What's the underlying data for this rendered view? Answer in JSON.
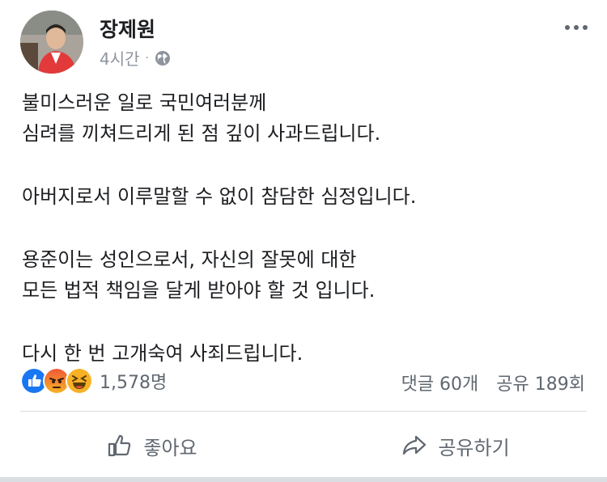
{
  "author": {
    "name": "장제원",
    "time": "4시간",
    "separator": "·"
  },
  "post": {
    "paragraphs": [
      [
        "불미스러운 일로 국민여러분께",
        "심려를 끼쳐드리게 된 점 깊이 사과드립니다."
      ],
      [
        "아버지로서 이루말할 수 없이 참담한 심정입니다."
      ],
      [
        "용준이는 성인으로서, 자신의 잘못에 대한",
        "모든 법적 책임을 달게 받아야 할 것 입니다."
      ],
      [
        "다시 한 번 고개숙여 사죄드립니다."
      ]
    ]
  },
  "reactions": {
    "icons": [
      "like-reaction-icon",
      "angry-reaction-icon",
      "haha-reaction-icon"
    ],
    "count": "1,578명"
  },
  "stats": {
    "comments": "댓글 60개",
    "shares": "공유 189회"
  },
  "actions": {
    "like": "좋아요",
    "share": "공유하기"
  },
  "colors": {
    "like_blue": "#1877f2",
    "angry_orange": "#f05937",
    "haha_yellow": "#f7b125",
    "secondary_text": "#606770"
  }
}
